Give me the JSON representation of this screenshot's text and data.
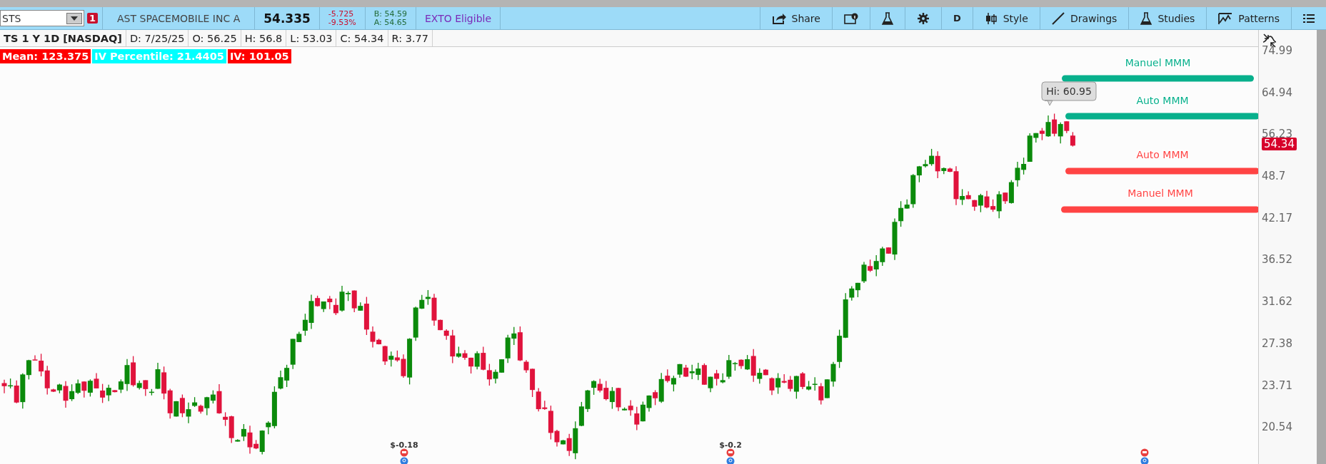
{
  "toolbar": {
    "symbol": "STS",
    "alert_badge": "1",
    "company": "AST SPACEMOBILE INC A",
    "last": "54.335",
    "change": "-5.725",
    "change_pct": "-9.53%",
    "bid": "B: 54.59",
    "ask": "A: 54.65",
    "exto": "EXTO Eligible",
    "buttons": [
      {
        "kind": "share",
        "label": "Share"
      },
      {
        "kind": "info"
      },
      {
        "kind": "flask"
      },
      {
        "kind": "gear"
      },
      {
        "kind": "text",
        "label": "D"
      },
      {
        "kind": "style",
        "label": "Style"
      },
      {
        "kind": "drawings",
        "label": "Drawings"
      },
      {
        "kind": "studies",
        "label": "Studies"
      },
      {
        "kind": "patterns",
        "label": "Patterns"
      },
      {
        "kind": "menu"
      }
    ]
  },
  "info_row": [
    "TS 1 Y 1D [NASDAQ]",
    "D: 7/25/25",
    "O: 56.25",
    "H: 56.8",
    "L: 53.03",
    "C: 54.34",
    "R: 3.77"
  ],
  "study_labels": [
    {
      "text": "Mean: 123.375",
      "color": "#ff0000"
    },
    {
      "text": "IV Percentile: 21.4405",
      "color": "#00ffff"
    },
    {
      "text": "IV: 101.05",
      "color": "#ff0000"
    }
  ],
  "chart": {
    "levels": [
      {
        "label": "Manuel MMM",
        "color": "#08b08c"
      },
      {
        "label": "Auto MMM",
        "color": "#08b08c"
      },
      {
        "label": "Auto MMM",
        "color": "#ff4444"
      },
      {
        "label": "Manuel MMM",
        "color": "#ff4444"
      }
    ],
    "hi_label": "Hi: 60.95",
    "events": [
      "$-0.18",
      "$-0.2"
    ]
  },
  "price_axis": {
    "ticks": [
      "74.99",
      "64.94",
      "56.23",
      "48.7",
      "42.17",
      "36.52",
      "31.62",
      "27.38",
      "23.71",
      "20.54"
    ],
    "last_price": "54.34"
  }
}
